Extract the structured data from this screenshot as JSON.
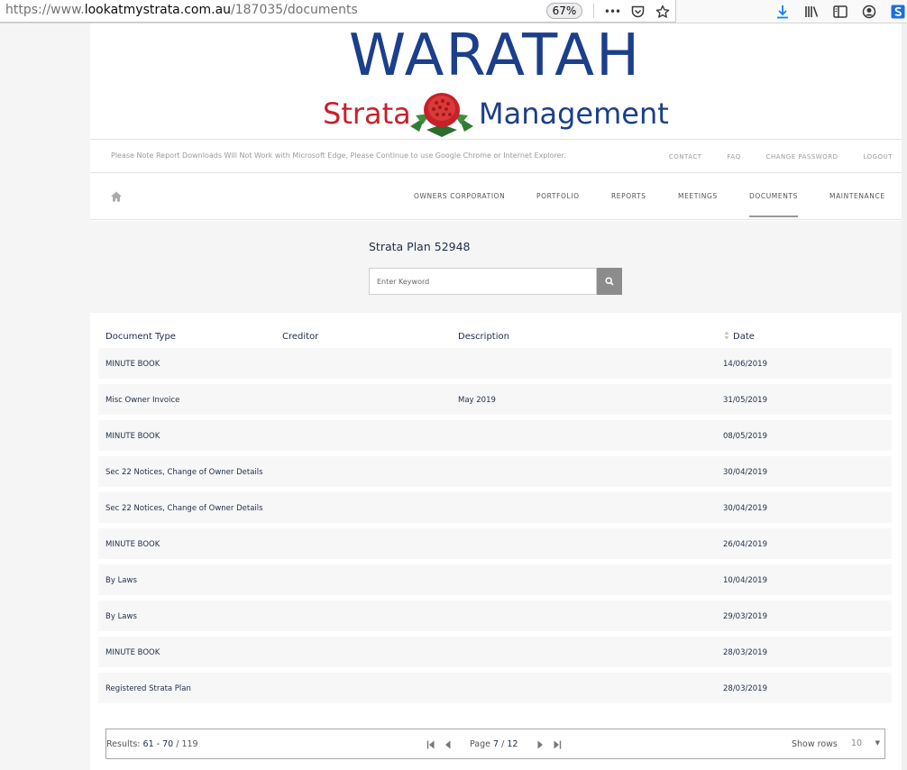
{
  "browser": {
    "url_prefix": "https://www.",
    "url_host": "lookatmystrata.com.au",
    "url_path": "/187035/documents",
    "zoom": "67%",
    "more_glyph": "•••"
  },
  "logo": {
    "title": "WARATAH",
    "sub_left": "Strata",
    "sub_right": "Management"
  },
  "notice": "Please Note Report Downloads Will Not Work with Microsoft Edge, Please Continue to use Google Chrome or Internet Explorer.",
  "top_links": [
    "CONTACT",
    "FAQ",
    "CHANGE PASSWORD",
    "LOGOUT"
  ],
  "nav": {
    "items": [
      {
        "label": "OWNERS CORPORATION"
      },
      {
        "label": "PORTFOLIO"
      },
      {
        "label": "REPORTS"
      },
      {
        "label": "MEETINGS"
      },
      {
        "label": "DOCUMENTS",
        "active": true
      },
      {
        "label": "MAINTENANCE"
      }
    ]
  },
  "search": {
    "plan_title": "Strata Plan 52948",
    "placeholder": "Enter Keyword"
  },
  "table": {
    "columns": [
      "Document Type",
      "Creditor",
      "Description",
      "Date"
    ],
    "rows": [
      {
        "type": "MINUTE BOOK",
        "creditor": "",
        "description": "",
        "date": "14/06/2019"
      },
      {
        "type": "Misc Owner Invoice",
        "creditor": "",
        "description": "May 2019",
        "date": "31/05/2019"
      },
      {
        "type": "MINUTE BOOK",
        "creditor": "",
        "description": "",
        "date": "08/05/2019"
      },
      {
        "type": "Sec 22 Notices, Change of Owner Details",
        "creditor": "",
        "description": "",
        "date": "30/04/2019"
      },
      {
        "type": "Sec 22 Notices, Change of Owner Details",
        "creditor": "",
        "description": "",
        "date": "30/04/2019"
      },
      {
        "type": "MINUTE BOOK",
        "creditor": "",
        "description": "",
        "date": "26/04/2019"
      },
      {
        "type": "By Laws",
        "creditor": "",
        "description": "",
        "date": "10/04/2019"
      },
      {
        "type": "By Laws",
        "creditor": "",
        "description": "",
        "date": "29/03/2019"
      },
      {
        "type": "MINUTE BOOK",
        "creditor": "",
        "description": "",
        "date": "28/03/2019"
      },
      {
        "type": "Registered Strata Plan",
        "creditor": "",
        "description": "",
        "date": "28/03/2019"
      }
    ]
  },
  "pager": {
    "results_label": "Results: ",
    "range": "61 - 70",
    "total_sep": " / ",
    "total": "119",
    "page_label": "Page ",
    "page_current": "7",
    "page_sep": " / ",
    "page_total": "12",
    "show_rows_label": "Show rows",
    "show_rows_value": "10"
  },
  "colors": {
    "brand_blue": "#1b3f8b",
    "brand_red": "#c8202a",
    "text_dark": "#1f2d4a"
  }
}
